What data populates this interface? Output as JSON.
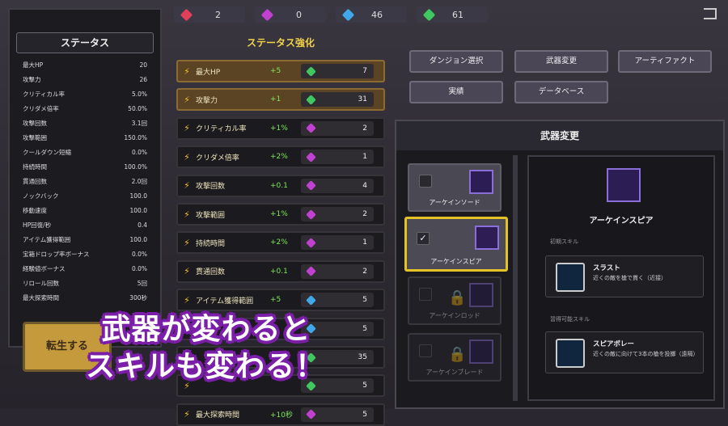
{
  "resources": [
    {
      "icon": "red-gem-icon",
      "color": "#e0405a",
      "value": "2"
    },
    {
      "icon": "purple-gem-icon",
      "color": "#c040d0",
      "value": "0"
    },
    {
      "icon": "blue-gem-icon",
      "color": "#40a8e8",
      "value": "46"
    },
    {
      "icon": "green-gem-icon",
      "color": "#40c860",
      "value": "61"
    }
  ],
  "status": {
    "title": "ステータス",
    "rows": [
      [
        "最大HP",
        "20"
      ],
      [
        "攻撃力",
        "26"
      ],
      [
        "クリティカル率",
        "5.0%"
      ],
      [
        "クリダメ倍率",
        "50.0%"
      ],
      [
        "攻撃回数",
        "3.1回"
      ],
      [
        "攻撃範囲",
        "150.0%"
      ],
      [
        "クールダウン短縮",
        "0.0%"
      ],
      [
        "持続時間",
        "100.0%"
      ],
      [
        "貫通回数",
        "2.0回"
      ],
      [
        "ノックバック",
        "100.0"
      ],
      [
        "移動速度",
        "100.0"
      ],
      [
        "HP回復/秒",
        "0.4"
      ],
      [
        "アイテム獲得範囲",
        "100.0"
      ],
      [
        "宝箱ドロップ率ボーナス",
        "0.0%"
      ],
      [
        "経験値ボーナス",
        "0.0%"
      ],
      [
        "リロール回数",
        "5回"
      ],
      [
        "最大探索時間",
        "300秒"
      ]
    ],
    "rebirth": "転生する"
  },
  "upgrade": {
    "title": "ステータス強化",
    "rows": [
      {
        "name": "最大HP",
        "inc": "+5",
        "gem": "#40c860",
        "cost": "7",
        "gold": true
      },
      {
        "name": "攻撃力",
        "inc": "+1",
        "gem": "#40c860",
        "cost": "31",
        "gold": true
      },
      {
        "name": "クリティカル率",
        "inc": "+1%",
        "gem": "#c040d0",
        "cost": "2",
        "gold": false
      },
      {
        "name": "クリダメ倍率",
        "inc": "+2%",
        "gem": "#c040d0",
        "cost": "1",
        "gold": false
      },
      {
        "name": "攻撃回数",
        "inc": "+0.1",
        "gem": "#c040d0",
        "cost": "4",
        "gold": false
      },
      {
        "name": "攻撃範囲",
        "inc": "+1%",
        "gem": "#c040d0",
        "cost": "2",
        "gold": false
      },
      {
        "name": "持続時間",
        "inc": "+2%",
        "gem": "#c040d0",
        "cost": "1",
        "gold": false
      },
      {
        "name": "貫通回数",
        "inc": "+0.1",
        "gem": "#c040d0",
        "cost": "2",
        "gold": false
      },
      {
        "name": "アイテム獲得範囲",
        "inc": "+5",
        "gem": "#40a8e8",
        "cost": "5",
        "gold": false
      },
      {
        "name": "",
        "inc": "",
        "gem": "#40a8e8",
        "cost": "5",
        "gold": false
      },
      {
        "name": "",
        "inc": "",
        "gem": "#40c860",
        "cost": "35",
        "gold": false
      },
      {
        "name": "",
        "inc": "",
        "gem": "#40c860",
        "cost": "5",
        "gold": false
      },
      {
        "name": "最大探索時間",
        "inc": "+10秒",
        "gem": "#c040d0",
        "cost": "5",
        "gold": false
      }
    ]
  },
  "menu": {
    "dungeon": "ダンジョン選択",
    "weapon": "武器変更",
    "artifact": "アーティファクト",
    "achievement": "実績",
    "database": "データベース"
  },
  "weapon_panel": {
    "title": "武器変更",
    "weapons": [
      {
        "name": "アーケインソード",
        "state": "normal"
      },
      {
        "name": "アーケインスピア",
        "state": "selected"
      },
      {
        "name": "アーケインロッド",
        "state": "locked"
      },
      {
        "name": "アーケインブレード",
        "state": "locked"
      }
    ],
    "detail": {
      "name": "アーケインスピア",
      "initial_label": "初期スキル",
      "skill1_name": "スラスト",
      "skill1_desc": "近くの敵を槍で貫く（近接）",
      "learn_label": "習得可能スキル",
      "skill2_name": "スピアボレー",
      "skill2_desc": "近くの敵に向けて3本の槍を投擲（遠隔）"
    }
  },
  "banner": {
    "line1": "武器が変わると",
    "line2": "スキルも変わる！"
  }
}
